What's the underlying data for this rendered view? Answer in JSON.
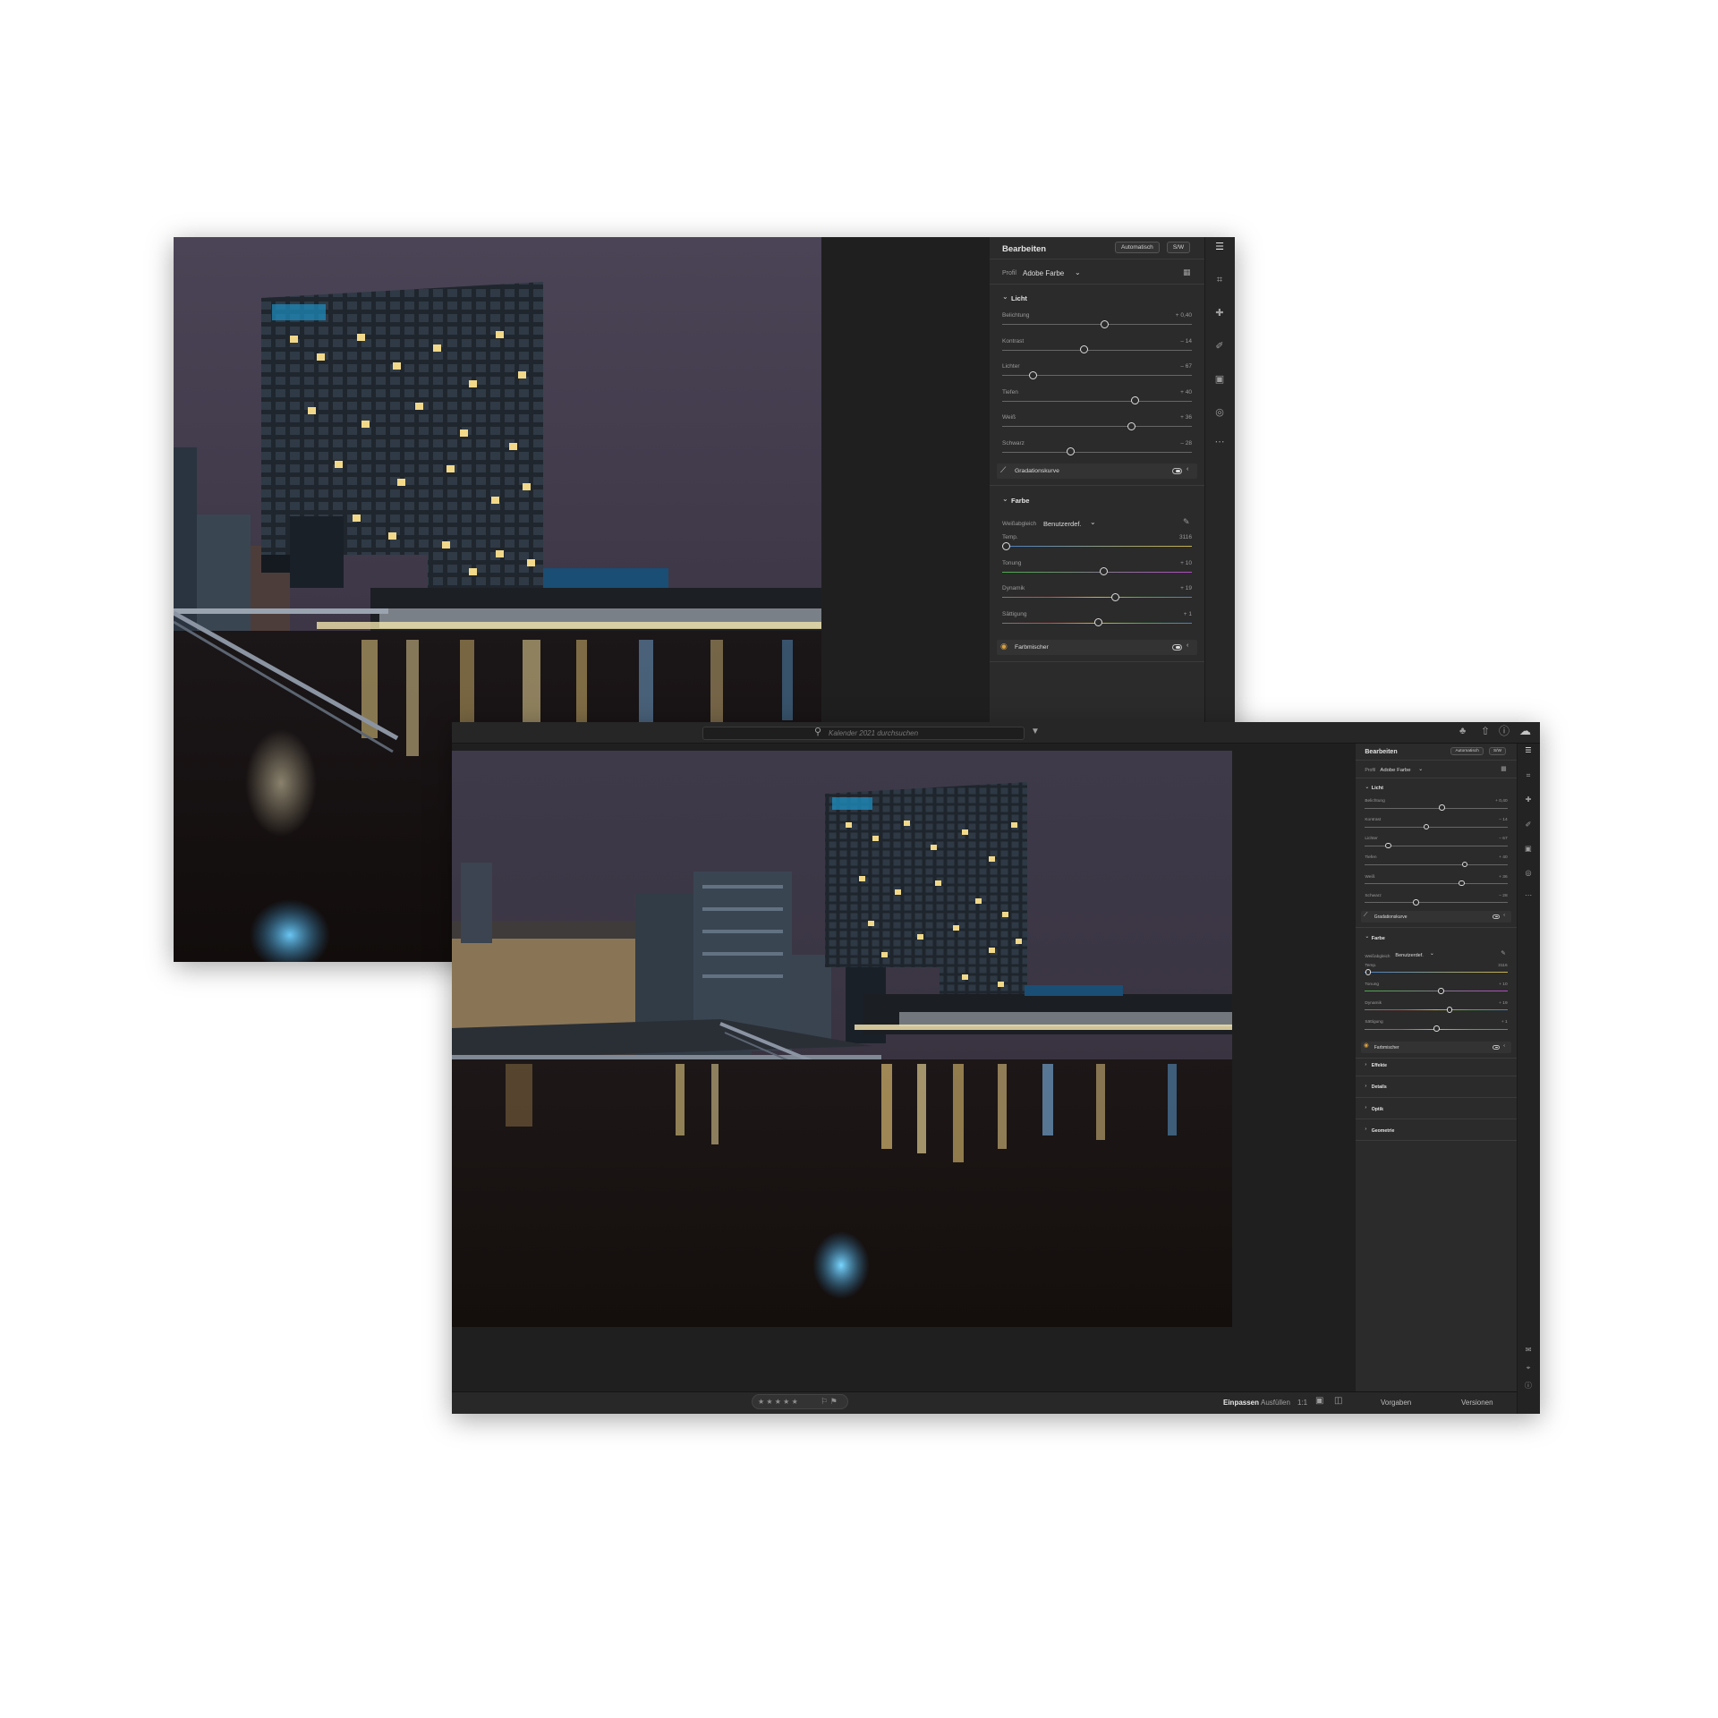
{
  "panel": {
    "title": "Bearbeiten",
    "auto_button": "Automatisch",
    "bw_button": "S/W",
    "profile_label": "Profil",
    "profile_value": "Adobe Farbe",
    "licht": {
      "title": "Licht",
      "sliders": [
        {
          "label": "Belichtung",
          "value_text": "+ 0,40",
          "value": 0.4,
          "min": -5,
          "max": 5
        },
        {
          "label": "Kontrast",
          "value_text": "– 14",
          "value": -14,
          "min": -100,
          "max": 100
        },
        {
          "label": "Lichter",
          "value_text": "– 67",
          "value": -67,
          "min": -100,
          "max": 100
        },
        {
          "label": "Tiefen",
          "value_text": "+ 40",
          "value": 40,
          "min": -100,
          "max": 100
        },
        {
          "label": "Weiß",
          "value_text": "+ 36",
          "value": 36,
          "min": -100,
          "max": 100
        },
        {
          "label": "Schwarz",
          "value_text": "– 28",
          "value": -28,
          "min": -100,
          "max": 100
        }
      ],
      "curve_label": "Gradationskurve"
    },
    "farbe": {
      "title": "Farbe",
      "wb_label": "Weißabgleich",
      "wb_value": "Benutzerdef.",
      "sliders": [
        {
          "label": "Temp.",
          "value_text": "3116",
          "value": 3116,
          "min": 2000,
          "max": 50000
        },
        {
          "label": "Tonung",
          "value_text": "+ 10",
          "value": 10,
          "min": -150,
          "max": 150
        },
        {
          "label": "Dynamik",
          "value_text": "+ 19",
          "value": 19,
          "min": -100,
          "max": 100
        },
        {
          "label": "Sättigung",
          "value_text": "+ 1",
          "value": 1,
          "min": -100,
          "max": 100
        }
      ],
      "mixer_label": "Farbmischer"
    },
    "collapsed": [
      "Effekte",
      "Details",
      "Optik",
      "Geometrie"
    ],
    "bottom_tabs": [
      "Vorgaben",
      "Versionen"
    ]
  },
  "topbar": {
    "search_placeholder": "Kalender 2021 durchsuchen"
  },
  "bottombar": {
    "stars": "★ ★ ★ ★ ★",
    "flags": "⚐ ⚑",
    "fit": "Einpassen",
    "fill": "Ausfüllen",
    "one_to_one": "1:1"
  },
  "icons": {
    "tools": [
      "sliders-icon",
      "crop-icon",
      "healing-icon",
      "brush-icon",
      "linear-gradient-icon",
      "radial-gradient-icon",
      "more-icon"
    ],
    "top": [
      "bell-icon",
      "share-icon",
      "help-icon",
      "cloud-icon"
    ],
    "right_bottom": [
      "comment-icon",
      "tag-icon",
      "info-icon"
    ]
  }
}
